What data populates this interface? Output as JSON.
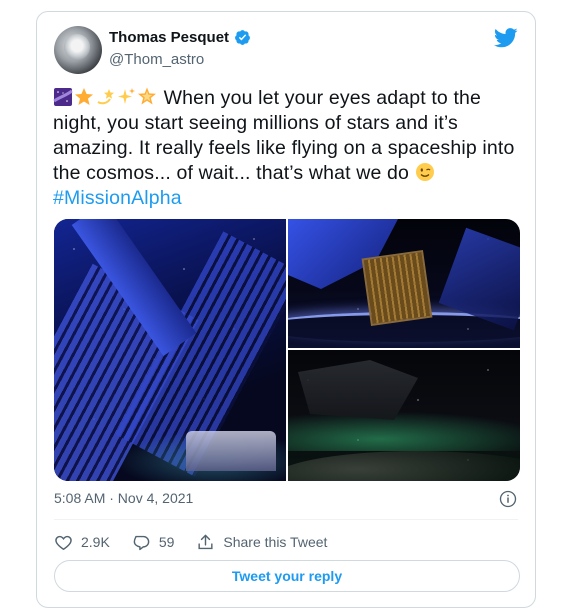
{
  "author": {
    "name": "Thomas Pesquet",
    "handle": "@Thom_astro"
  },
  "tweet": {
    "emojis": [
      "milky-way-emoji",
      "star-emoji",
      "dizzy-emoji",
      "sparkles-emoji",
      "glowing-star-emoji"
    ],
    "text": "When you let your eyes adapt to the night, you start seeing millions of stars and it’s amazing. It really feels like flying on a spaceship into the cosmos... of wait... that’s what we do",
    "trailing_emoji": "winking-face-emoji",
    "hashtag": "#MissionAlpha"
  },
  "meta": {
    "timestamp": "5:08 AM · Nov 4, 2021"
  },
  "actions": {
    "likes": "2.9K",
    "replies": "59",
    "share_label": "Share this Tweet"
  },
  "reply_button": {
    "label": "Tweet your reply"
  },
  "colors": {
    "accent": "#1d9bf0",
    "secondary_text": "#536471",
    "border": "#cfd9de"
  }
}
